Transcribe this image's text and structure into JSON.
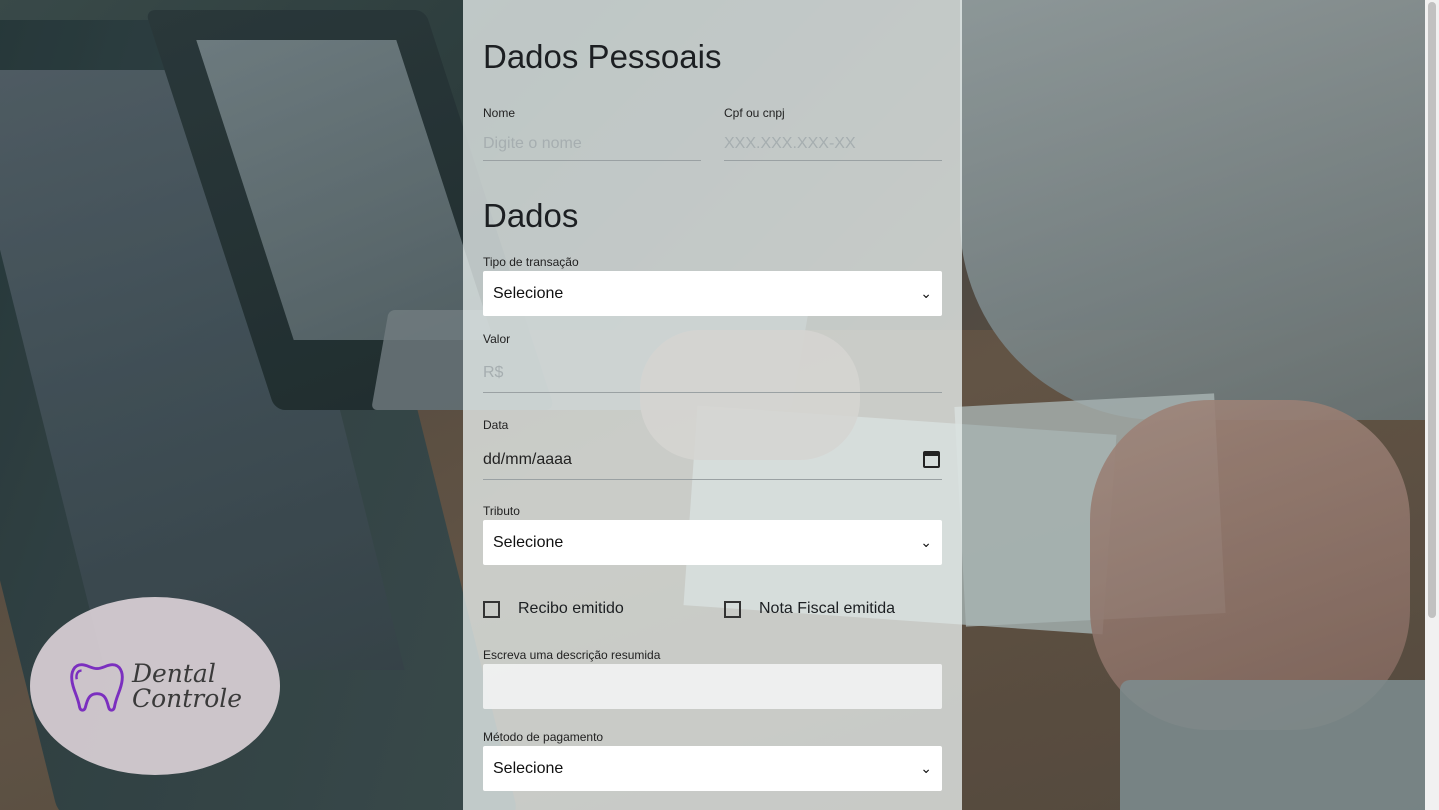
{
  "sections": {
    "personal_title": "Dados Pessoais",
    "data_title": "Dados"
  },
  "personal": {
    "name_label": "Nome",
    "name_placeholder": "Digite o nome",
    "doc_label": "Cpf ou cnpj",
    "doc_placeholder": "XXX.XXX.XXX-XX"
  },
  "fields": {
    "transaction_type_label": "Tipo de transação",
    "transaction_type_value": "Selecione",
    "value_label": "Valor",
    "value_placeholder": "R$",
    "date_label": "Data",
    "date_placeholder": "dd/mm/aaaa",
    "tribute_label": "Tributo",
    "tribute_value": "Selecione",
    "receipt_label": "Recibo emitido",
    "invoice_label": "Nota Fiscal emitida",
    "description_label": "Escreva uma descrição resumida",
    "payment_method_label": "Método de pagamento",
    "payment_method_value": "Selecione"
  },
  "logo": {
    "line1": "Dental",
    "line2": "Controle",
    "tooth_color": "#7b2fbf"
  },
  "icons": {
    "select_chevron": "chevron-down-icon",
    "calendar": "calendar-icon",
    "tooth": "tooth-icon"
  }
}
